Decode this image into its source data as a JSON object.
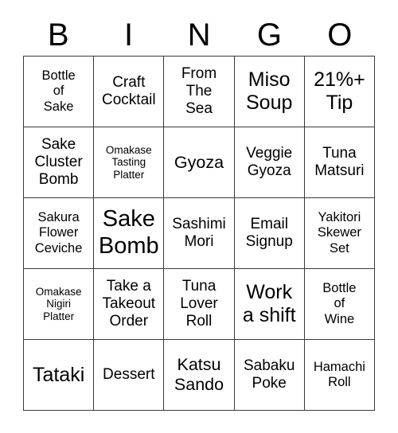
{
  "header": {
    "letters": [
      "B",
      "I",
      "N",
      "G",
      "O"
    ]
  },
  "grid": {
    "rows": 5,
    "columns": 5,
    "border_color": "#3a3a3a",
    "cell_background": "#ffffff",
    "text_color": "#000000",
    "cells": [
      {
        "text": "Bottle\nof\nSake",
        "size": "fs-sm"
      },
      {
        "text": "Craft\nCocktail",
        "size": "fs-md"
      },
      {
        "text": "From\nThe\nSea",
        "size": "fs-md"
      },
      {
        "text": "Miso\nSoup",
        "size": "fs-xl"
      },
      {
        "text": "21%+\nTip",
        "size": "fs-xl"
      },
      {
        "text": "Sake\nCluster\nBomb",
        "size": "fs-md"
      },
      {
        "text": "Omakase\nTasting\nPlatter",
        "size": "fs-xs"
      },
      {
        "text": "Gyoza",
        "size": "fs-lg"
      },
      {
        "text": "Veggie\nGyoza",
        "size": "fs-md"
      },
      {
        "text": "Tuna\nMatsuri",
        "size": "fs-md"
      },
      {
        "text": "Sakura\nFlower\nCeviche",
        "size": "fs-sm"
      },
      {
        "text": "Sake\nBomb",
        "size": "fs-xxl"
      },
      {
        "text": "Sashimi\nMori",
        "size": "fs-md"
      },
      {
        "text": "Email\nSignup",
        "size": "fs-md"
      },
      {
        "text": "Yakitori\nSkewer\nSet",
        "size": "fs-sm"
      },
      {
        "text": "Omakase\nNigiri\nPlatter",
        "size": "fs-xs"
      },
      {
        "text": "Take a\nTakeout\nOrder",
        "size": "fs-md"
      },
      {
        "text": "Tuna\nLover\nRoll",
        "size": "fs-md"
      },
      {
        "text": "Work\na shift",
        "size": "fs-xl"
      },
      {
        "text": "Bottle\nof\nWine",
        "size": "fs-sm"
      },
      {
        "text": "Tataki",
        "size": "fs-xl"
      },
      {
        "text": "Dessert",
        "size": "fs-md"
      },
      {
        "text": "Katsu\nSando",
        "size": "fs-lg"
      },
      {
        "text": "Sabaku\nPoke",
        "size": "fs-md"
      },
      {
        "text": "Hamachi\nRoll",
        "size": "fs-sm"
      }
    ]
  }
}
